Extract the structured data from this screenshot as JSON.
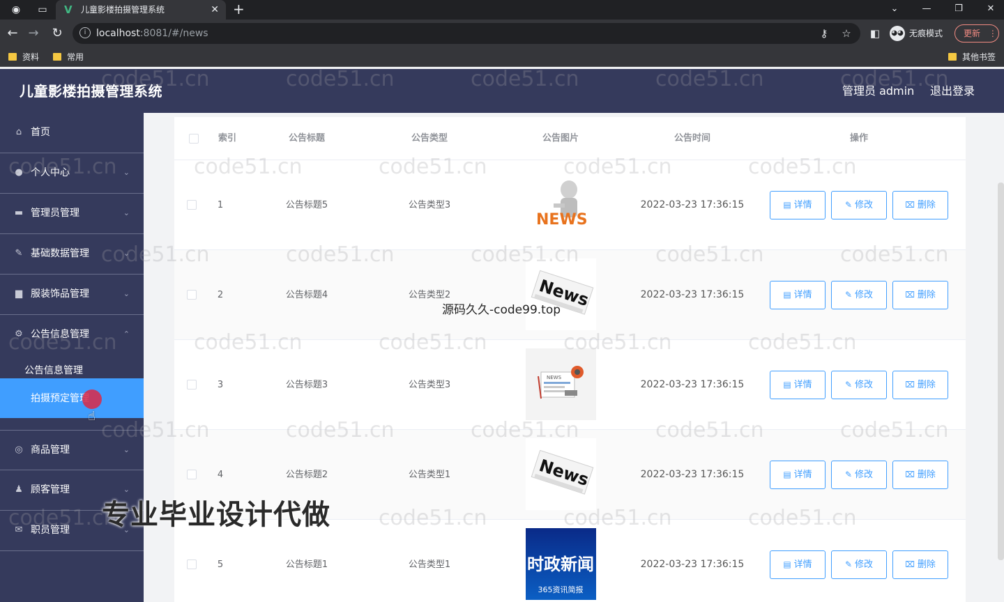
{
  "browser": {
    "tab_title": "儿童影楼拍摄管理系统",
    "url_host": "localhost",
    "url_rest": ":8081/#/news",
    "incognito_label": "无痕模式",
    "update_label": "更新",
    "bookmarks": [
      "资料",
      "常用"
    ],
    "other_bookmarks": "其他书签"
  },
  "header": {
    "title": "儿童影楼拍摄管理系统",
    "admin_label": "管理员 admin",
    "logout_label": "退出登录"
  },
  "sidebar": {
    "items": [
      {
        "label": "首页",
        "icon": "home-icon"
      },
      {
        "label": "个人中心",
        "icon": "user-icon"
      },
      {
        "label": "管理员管理",
        "icon": "monitor-icon"
      },
      {
        "label": "基础数据管理",
        "icon": "edit-icon"
      },
      {
        "label": "服装饰品管理",
        "icon": "ticket-icon"
      },
      {
        "label": "公告信息管理",
        "icon": "settings-icon"
      },
      {
        "label": "商品管理",
        "icon": "circle-icon"
      },
      {
        "label": "顾客管理",
        "icon": "person-icon"
      },
      {
        "label": "职员管理",
        "icon": "mail-icon"
      }
    ],
    "submenu": [
      {
        "label": "公告信息管理"
      },
      {
        "label": "拍摄预定管理"
      }
    ]
  },
  "table": {
    "headers": {
      "index": "索引",
      "title": "公告标题",
      "type": "公告类型",
      "image": "公告图片",
      "time": "公告时间",
      "actions": "操作"
    },
    "buttons": {
      "detail": "详情",
      "edit": "修改",
      "delete": "删除"
    },
    "rows": [
      {
        "index": "1",
        "title": "公告标题5",
        "type": "公告类型3",
        "time": "2022-03-23 17:36:15",
        "image_text": "NEWS"
      },
      {
        "index": "2",
        "title": "公告标题4",
        "type": "公告类型2",
        "time": "2022-03-23 17:36:15",
        "image_text": "News"
      },
      {
        "index": "3",
        "title": "公告标题3",
        "type": "公告类型3",
        "time": "2022-03-23 17:36:15",
        "image_text": "NEWS"
      },
      {
        "index": "4",
        "title": "公告标题2",
        "type": "公告类型1",
        "time": "2022-03-23 17:36:15",
        "image_text": "News"
      },
      {
        "index": "5",
        "title": "公告标题1",
        "type": "公告类型1",
        "time": "2022-03-23 17:36:15",
        "image_text": "时政新闻",
        "image_subtext": "365资讯简报"
      }
    ]
  },
  "overlays": {
    "watermark": "code51.cn",
    "source_text": "源码久久-code99.top",
    "ad_text": "专业毕业设计代做"
  },
  "colors": {
    "header_bg": "#353a5c",
    "accent": "#409eff"
  }
}
